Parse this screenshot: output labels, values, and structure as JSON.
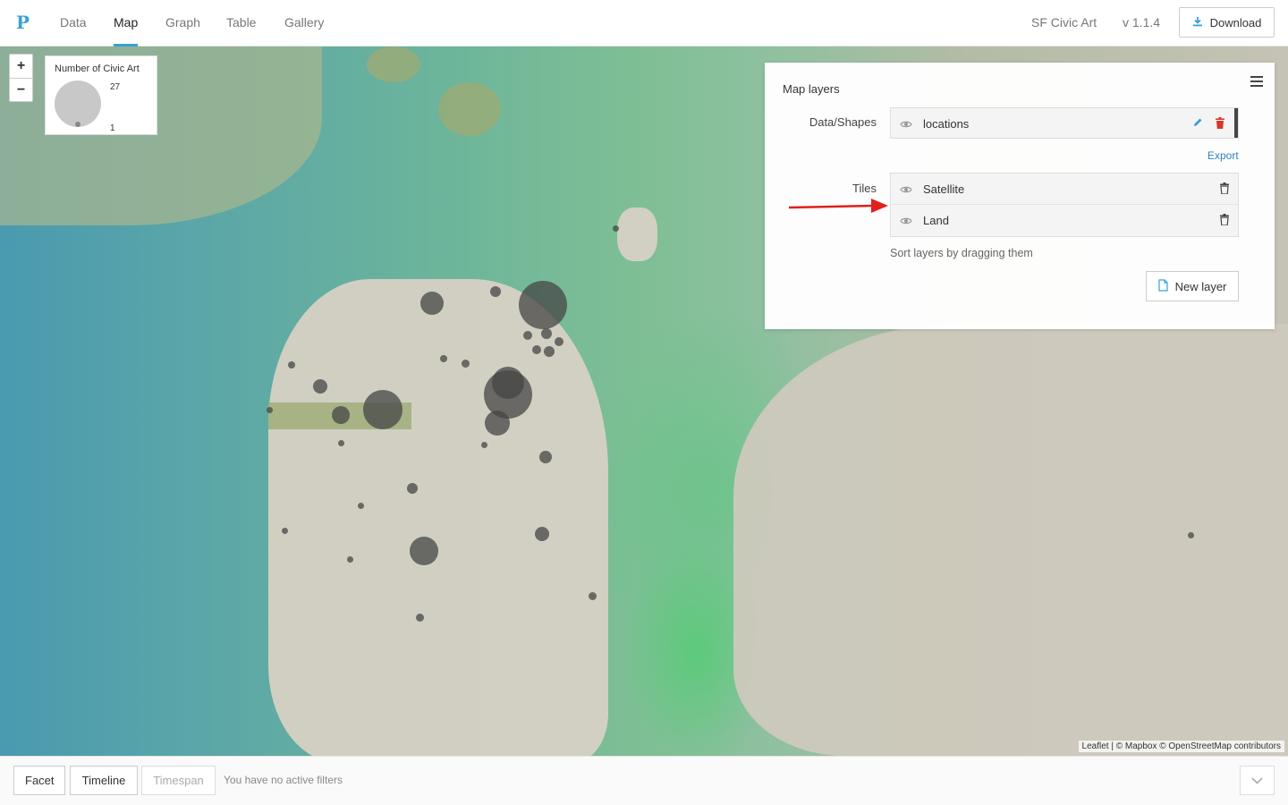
{
  "nav": {
    "logo": "P",
    "tabs": [
      {
        "label": "Data"
      },
      {
        "label": "Map",
        "active": true
      },
      {
        "label": "Graph"
      },
      {
        "label": "Table"
      },
      {
        "label": "Gallery"
      }
    ],
    "project_name": "SF Civic Art",
    "version": "v 1.1.4",
    "download_label": "Download"
  },
  "map": {
    "zoom_in": "+",
    "zoom_out": "−",
    "legend": {
      "title": "Number of Civic Art",
      "max": "27",
      "min": "1"
    },
    "attribution": "Leaflet | © Mapbox © OpenStreetMap contributors"
  },
  "layers_panel": {
    "title": "Map layers",
    "data_shapes_label": "Data/Shapes",
    "data_layers": [
      {
        "name": "locations"
      }
    ],
    "export_label": "Export",
    "tiles_label": "Tiles",
    "tile_layers": [
      {
        "name": "Satellite"
      },
      {
        "name": "Land"
      }
    ],
    "sort_hint": "Sort layers by dragging them",
    "new_layer_label": "New layer"
  },
  "bottom": {
    "facet_label": "Facet",
    "timeline_label": "Timeline",
    "timespan_label": "Timespan",
    "filter_status": "You have no active filters"
  },
  "colors": {
    "accent": "#3aa0d8",
    "annotation_arrow": "#e0201c",
    "delete": "#d9352b"
  }
}
